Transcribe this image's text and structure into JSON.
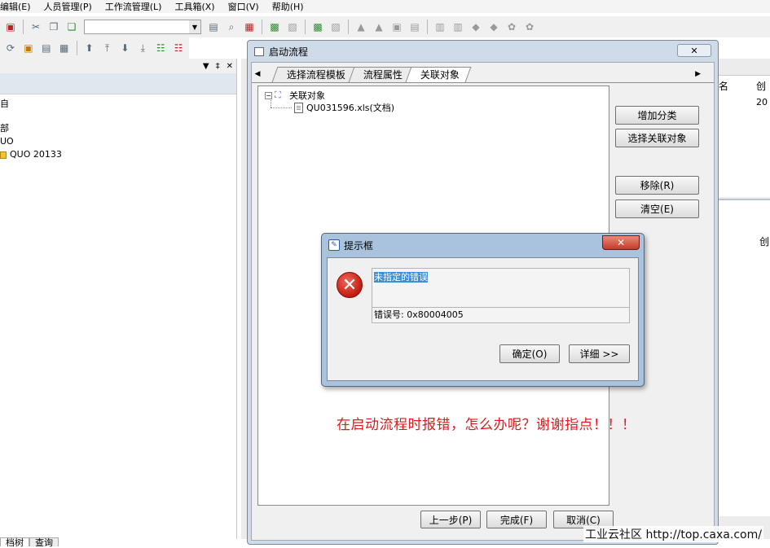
{
  "menubar": {
    "items": [
      "编辑(E)",
      "人员管理(P)",
      "工作流管理(L)",
      "工具箱(X)",
      "窗口(V)",
      "帮助(H)"
    ]
  },
  "left_panel": {
    "rows": [
      "自",
      "部",
      "UO",
      "QUO 20133"
    ],
    "bottom_tabs": [
      "档树",
      "查询"
    ]
  },
  "right_panel": {
    "col_name": "名",
    "col_created": "创",
    "cell_value": "20",
    "col_created_2": "创"
  },
  "workflow_dialog": {
    "title": "启动流程",
    "tabs": [
      "选择流程模板",
      "流程属性",
      "关联对象"
    ],
    "active_tab": "关联对象",
    "tree_root": "关联对象",
    "tree_child": "QU031596.xls(文档)",
    "buttons": {
      "add_category": "增加分类",
      "select_related": "选择关联对象",
      "remove": "移除(R)",
      "clear": "清空(E)",
      "prev": "上一步(P)",
      "finish": "完成(F)",
      "cancel": "取消(C)"
    }
  },
  "error_dialog": {
    "title": "提示框",
    "message": "未指定的错误",
    "error_code": "错误号: 0x80004005",
    "ok_label": "确定(O)",
    "details_label": "详细 >>",
    "close_glyph": "✕"
  },
  "annotation": "在启动流程时报错，怎么办呢？谢谢指点！！！",
  "watermark": "工业云社区 http://top.caxa.com/",
  "colors": {
    "accent_blue": "#a9c3de",
    "annotation_red": "#e0181e",
    "error_red": "#c21a10",
    "selection_blue": "#3b8fd6"
  }
}
